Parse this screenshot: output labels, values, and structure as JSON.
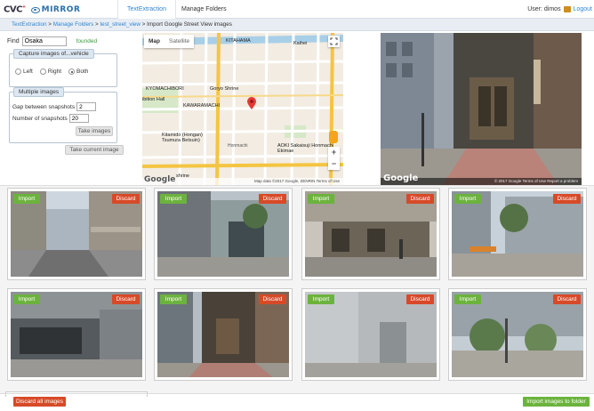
{
  "nav": {
    "logo_cvc": "CVC",
    "logo_mirror": "MIRROR",
    "tabs": [
      {
        "label": "TextExtraction",
        "active": true
      },
      {
        "label": "Manage Folders",
        "active": false
      }
    ],
    "user_label": "User: dimos",
    "logout_label": "Logout"
  },
  "breadcrumb": {
    "items": [
      "TextExtraction",
      "Manage Folders",
      "test_street_view"
    ],
    "current": "Import Google Street View images"
  },
  "search": {
    "find_label": "Find",
    "value": "Osaka",
    "status": "founded"
  },
  "capture": {
    "legend": "Capture images of...vehicle",
    "options": [
      {
        "label": "Left",
        "checked": false
      },
      {
        "label": "Right",
        "checked": false
      },
      {
        "label": "Both",
        "checked": true
      }
    ]
  },
  "multiple": {
    "legend": "Multiple images",
    "gap_label": "Gap between snapshots",
    "gap_value": "2",
    "number_label": "Number of snapshots",
    "number_value": "20",
    "take_images_label": "Take images"
  },
  "take_current_label": "Take current image",
  "map": {
    "type_map": "Map",
    "type_satellite": "Satellite",
    "labels": {
      "kitahama": "KITAHAMA",
      "kaihei": "Kaihei",
      "kyomachibori": "KYOMACHIBORI",
      "goryo": "Goryo Shrine",
      "kawaramachi": "KAWARAMACHI",
      "honmachi": "Honmachi",
      "kitamido": "Kitamido (Hongan) Tsumura Betsuin)",
      "aoki": "AOKI Sakaisuji Honmachi Ekimae",
      "hall": "ibition Hall",
      "shrine": "shrine"
    },
    "attribution": "Map data ©2017 Google, ZENRIN   Terms of Use",
    "google": "Google"
  },
  "streetview": {
    "google": "Google",
    "attribution": "© 2017 Google   Terms of Use   Report a problem"
  },
  "gallery": {
    "import_label": "Import",
    "discard_label": "Discard",
    "thumbs": [
      {
        "scene": "street-a"
      },
      {
        "scene": "building-glass"
      },
      {
        "scene": "shopfront"
      },
      {
        "scene": "office-plaza"
      },
      {
        "scene": "parking"
      },
      {
        "scene": "narrow-entrance"
      },
      {
        "scene": "grey-wall"
      },
      {
        "scene": "garden"
      }
    ]
  },
  "footer": {
    "discard_all_label": "Discard all images",
    "import_folder_label": "Import images to folder"
  }
}
